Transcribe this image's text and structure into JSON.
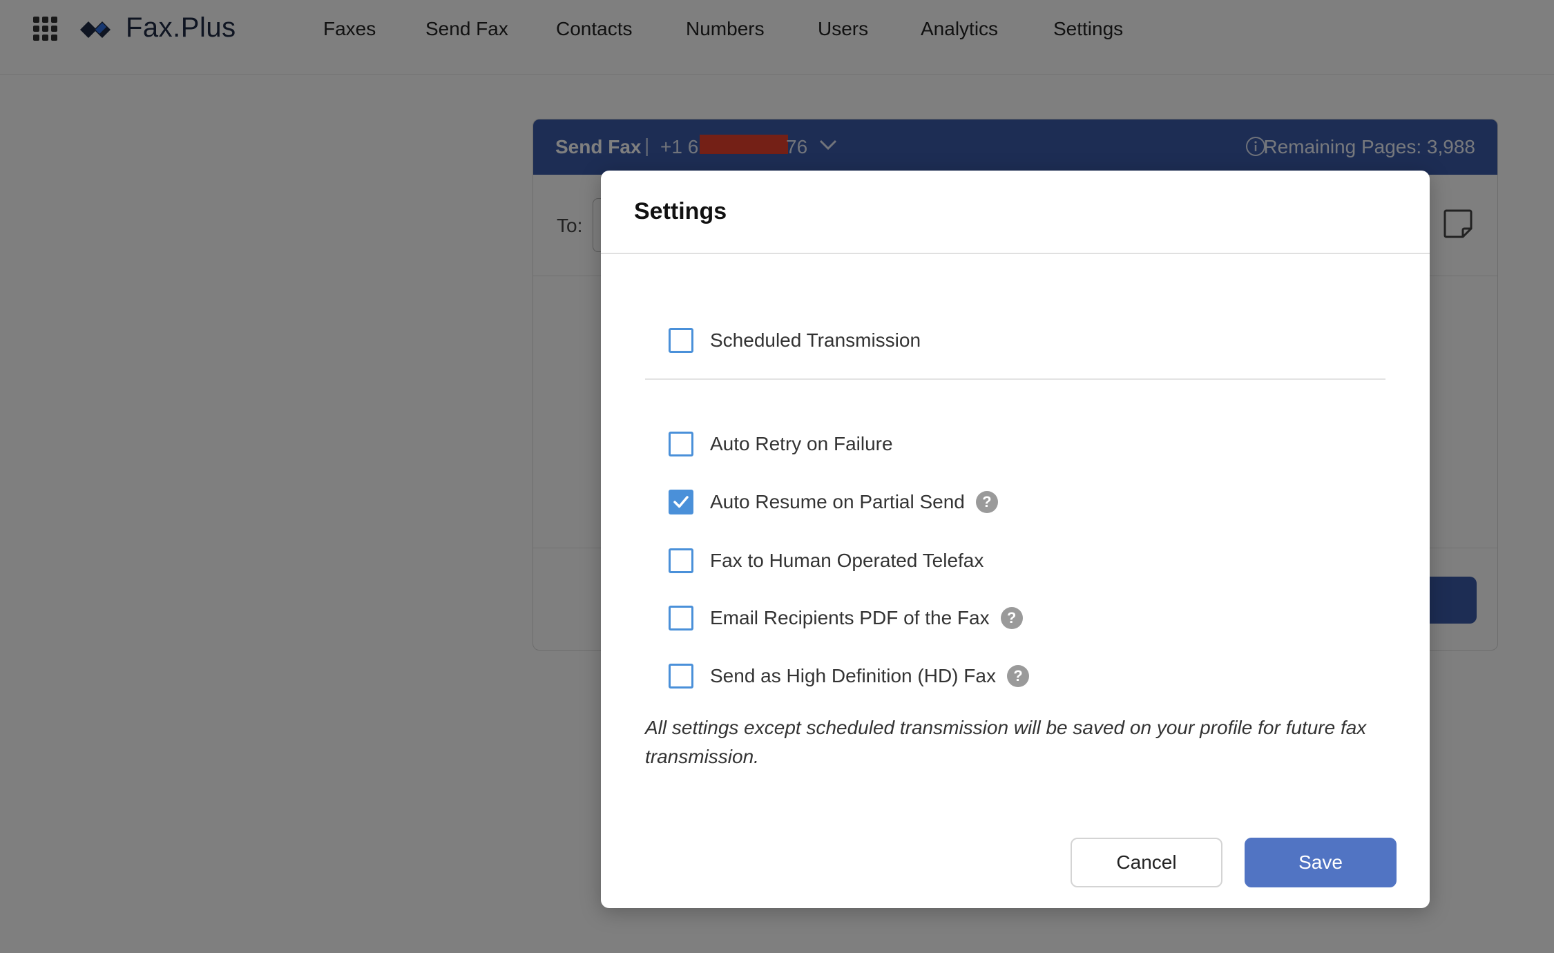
{
  "brand": {
    "name": "Fax.Plus"
  },
  "nav": {
    "items": [
      {
        "label": "Faxes"
      },
      {
        "label": "Send Fax"
      },
      {
        "label": "Contacts"
      },
      {
        "label": "Numbers"
      },
      {
        "label": "Users"
      },
      {
        "label": "Analytics"
      },
      {
        "label": "Settings"
      }
    ]
  },
  "send_card": {
    "title": "Send Fax",
    "separator": "|",
    "number_prefix": "+1 6",
    "number_suffix": "76",
    "remaining": "Remaining Pages: 3,988",
    "to_label": "To:"
  },
  "modal": {
    "title": "Settings",
    "options": [
      {
        "label": "Scheduled Transmission",
        "checked": false,
        "help": false
      },
      {
        "label": "Auto Retry on Failure",
        "checked": false,
        "help": false
      },
      {
        "label": "Auto Resume on Partial Send",
        "checked": true,
        "help": true
      },
      {
        "label": "Fax to Human Operated Telefax",
        "checked": false,
        "help": false
      },
      {
        "label": "Email Recipients PDF of the Fax",
        "checked": false,
        "help": true
      },
      {
        "label": "Send as High Definition (HD) Fax",
        "checked": false,
        "help": true
      }
    ],
    "help_glyph": "?",
    "note": "All settings except scheduled transmission will be saved on your profile for future fax transmission.",
    "cancel_label": "Cancel",
    "save_label": "Save"
  },
  "colors": {
    "header_blue": "#3a5aa8",
    "checkbox_blue": "#4a90d9",
    "save_blue": "#5174c3",
    "redaction": "#e8412c"
  }
}
